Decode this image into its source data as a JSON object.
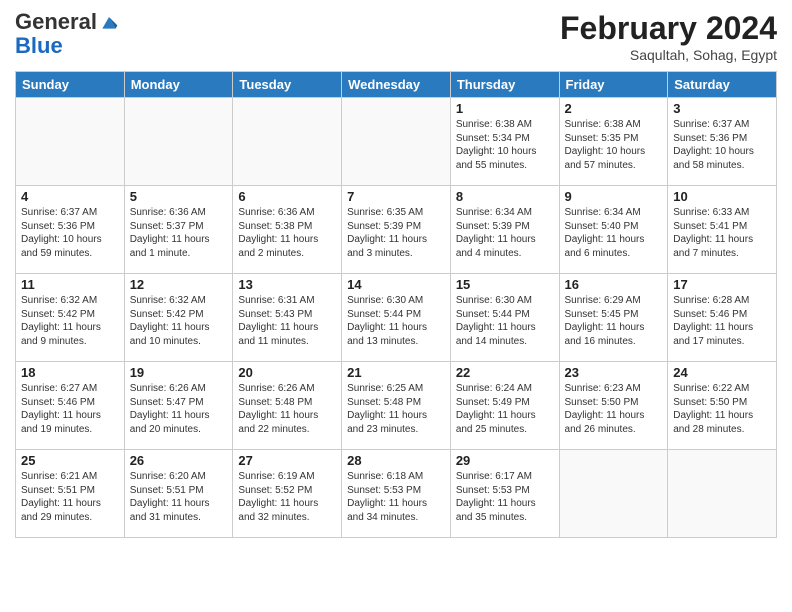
{
  "logo": {
    "general": "General",
    "blue": "Blue"
  },
  "header": {
    "title": "February 2024",
    "subtitle": "Saqultah, Sohag, Egypt"
  },
  "weekdays": [
    "Sunday",
    "Monday",
    "Tuesday",
    "Wednesday",
    "Thursday",
    "Friday",
    "Saturday"
  ],
  "weeks": [
    [
      {
        "day": "",
        "info": ""
      },
      {
        "day": "",
        "info": ""
      },
      {
        "day": "",
        "info": ""
      },
      {
        "day": "",
        "info": ""
      },
      {
        "day": "1",
        "info": "Sunrise: 6:38 AM\nSunset: 5:34 PM\nDaylight: 10 hours and 55 minutes."
      },
      {
        "day": "2",
        "info": "Sunrise: 6:38 AM\nSunset: 5:35 PM\nDaylight: 10 hours and 57 minutes."
      },
      {
        "day": "3",
        "info": "Sunrise: 6:37 AM\nSunset: 5:36 PM\nDaylight: 10 hours and 58 minutes."
      }
    ],
    [
      {
        "day": "4",
        "info": "Sunrise: 6:37 AM\nSunset: 5:36 PM\nDaylight: 10 hours and 59 minutes."
      },
      {
        "day": "5",
        "info": "Sunrise: 6:36 AM\nSunset: 5:37 PM\nDaylight: 11 hours and 1 minute."
      },
      {
        "day": "6",
        "info": "Sunrise: 6:36 AM\nSunset: 5:38 PM\nDaylight: 11 hours and 2 minutes."
      },
      {
        "day": "7",
        "info": "Sunrise: 6:35 AM\nSunset: 5:39 PM\nDaylight: 11 hours and 3 minutes."
      },
      {
        "day": "8",
        "info": "Sunrise: 6:34 AM\nSunset: 5:39 PM\nDaylight: 11 hours and 4 minutes."
      },
      {
        "day": "9",
        "info": "Sunrise: 6:34 AM\nSunset: 5:40 PM\nDaylight: 11 hours and 6 minutes."
      },
      {
        "day": "10",
        "info": "Sunrise: 6:33 AM\nSunset: 5:41 PM\nDaylight: 11 hours and 7 minutes."
      }
    ],
    [
      {
        "day": "11",
        "info": "Sunrise: 6:32 AM\nSunset: 5:42 PM\nDaylight: 11 hours and 9 minutes."
      },
      {
        "day": "12",
        "info": "Sunrise: 6:32 AM\nSunset: 5:42 PM\nDaylight: 11 hours and 10 minutes."
      },
      {
        "day": "13",
        "info": "Sunrise: 6:31 AM\nSunset: 5:43 PM\nDaylight: 11 hours and 11 minutes."
      },
      {
        "day": "14",
        "info": "Sunrise: 6:30 AM\nSunset: 5:44 PM\nDaylight: 11 hours and 13 minutes."
      },
      {
        "day": "15",
        "info": "Sunrise: 6:30 AM\nSunset: 5:44 PM\nDaylight: 11 hours and 14 minutes."
      },
      {
        "day": "16",
        "info": "Sunrise: 6:29 AM\nSunset: 5:45 PM\nDaylight: 11 hours and 16 minutes."
      },
      {
        "day": "17",
        "info": "Sunrise: 6:28 AM\nSunset: 5:46 PM\nDaylight: 11 hours and 17 minutes."
      }
    ],
    [
      {
        "day": "18",
        "info": "Sunrise: 6:27 AM\nSunset: 5:46 PM\nDaylight: 11 hours and 19 minutes."
      },
      {
        "day": "19",
        "info": "Sunrise: 6:26 AM\nSunset: 5:47 PM\nDaylight: 11 hours and 20 minutes."
      },
      {
        "day": "20",
        "info": "Sunrise: 6:26 AM\nSunset: 5:48 PM\nDaylight: 11 hours and 22 minutes."
      },
      {
        "day": "21",
        "info": "Sunrise: 6:25 AM\nSunset: 5:48 PM\nDaylight: 11 hours and 23 minutes."
      },
      {
        "day": "22",
        "info": "Sunrise: 6:24 AM\nSunset: 5:49 PM\nDaylight: 11 hours and 25 minutes."
      },
      {
        "day": "23",
        "info": "Sunrise: 6:23 AM\nSunset: 5:50 PM\nDaylight: 11 hours and 26 minutes."
      },
      {
        "day": "24",
        "info": "Sunrise: 6:22 AM\nSunset: 5:50 PM\nDaylight: 11 hours and 28 minutes."
      }
    ],
    [
      {
        "day": "25",
        "info": "Sunrise: 6:21 AM\nSunset: 5:51 PM\nDaylight: 11 hours and 29 minutes."
      },
      {
        "day": "26",
        "info": "Sunrise: 6:20 AM\nSunset: 5:51 PM\nDaylight: 11 hours and 31 minutes."
      },
      {
        "day": "27",
        "info": "Sunrise: 6:19 AM\nSunset: 5:52 PM\nDaylight: 11 hours and 32 minutes."
      },
      {
        "day": "28",
        "info": "Sunrise: 6:18 AM\nSunset: 5:53 PM\nDaylight: 11 hours and 34 minutes."
      },
      {
        "day": "29",
        "info": "Sunrise: 6:17 AM\nSunset: 5:53 PM\nDaylight: 11 hours and 35 minutes."
      },
      {
        "day": "",
        "info": ""
      },
      {
        "day": "",
        "info": ""
      }
    ]
  ]
}
